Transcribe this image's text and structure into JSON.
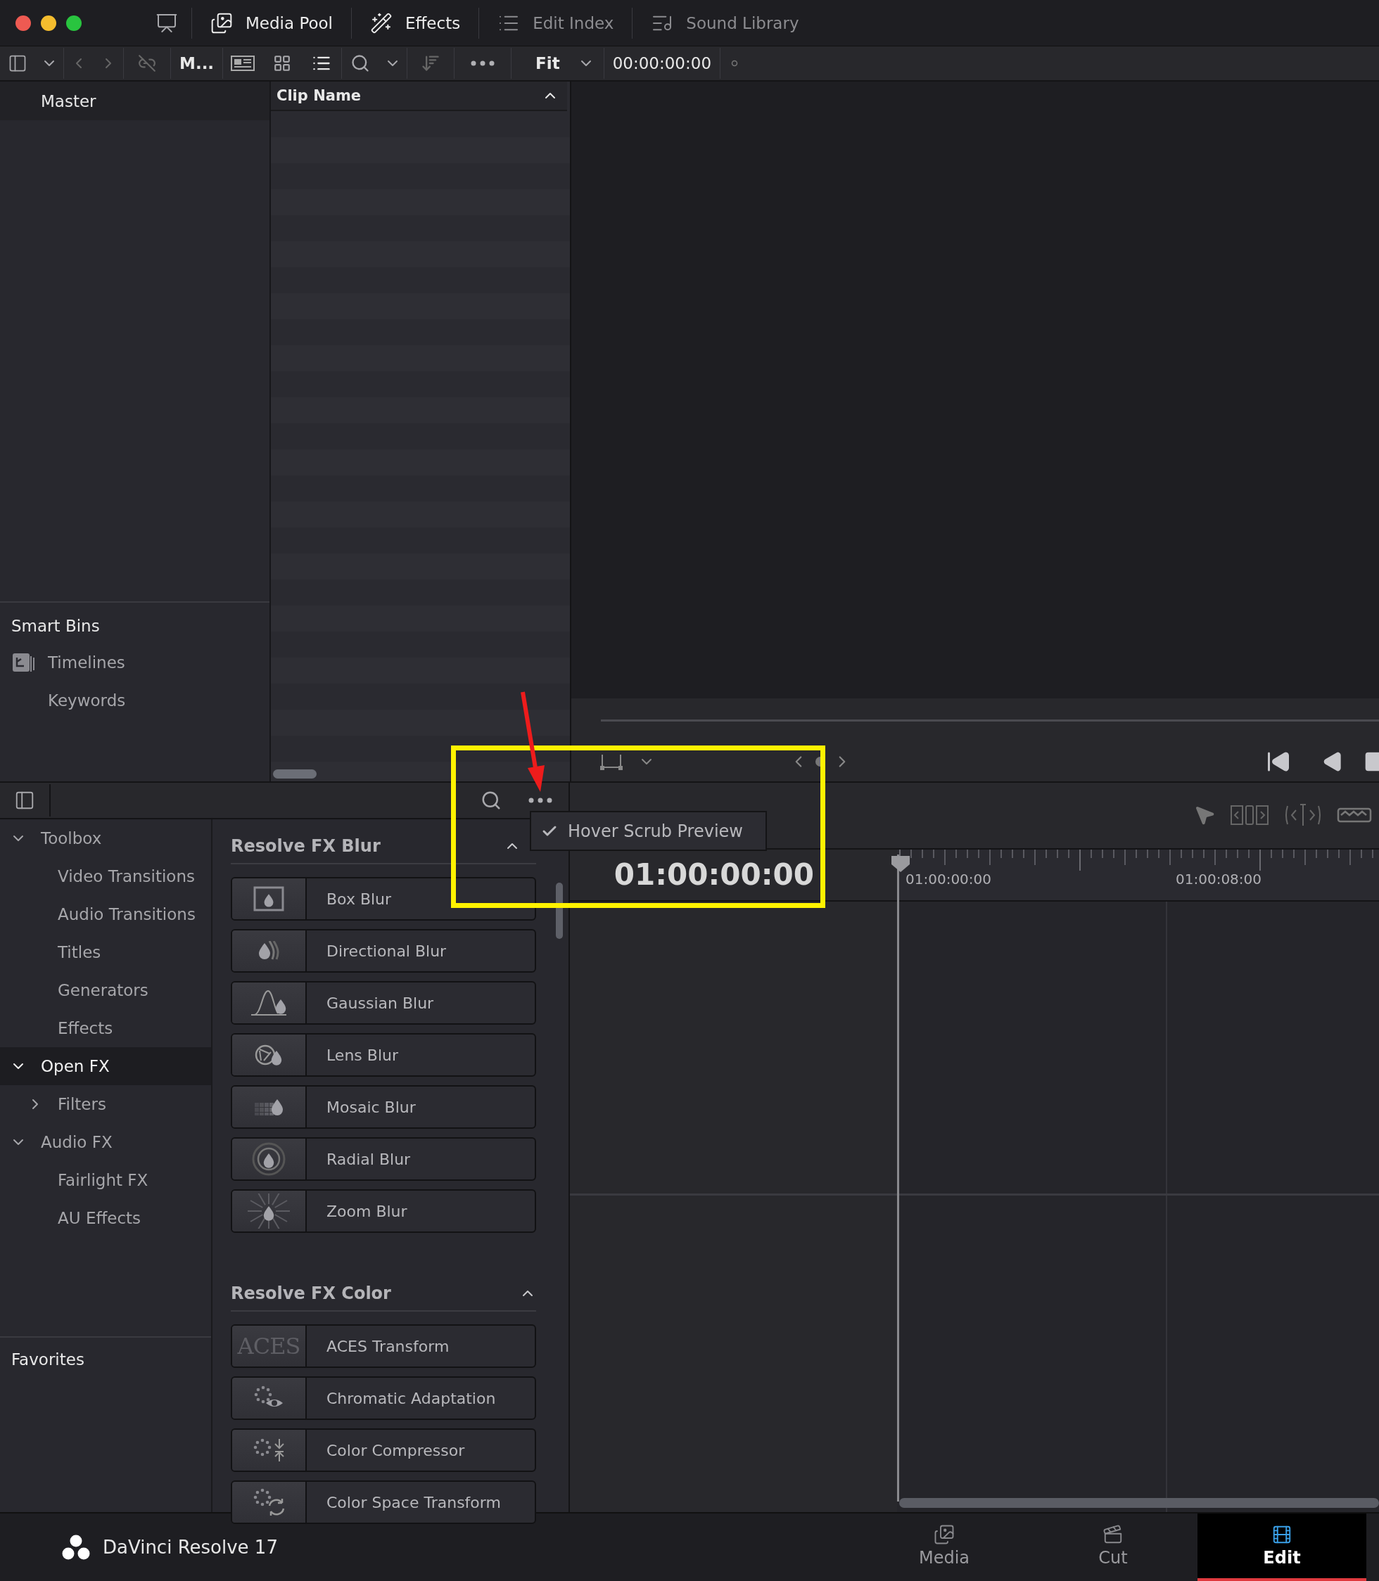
{
  "title_bar": {
    "tabs": [
      {
        "label": "Media Pool",
        "selected": true
      },
      {
        "label": "Effects",
        "selected": true
      },
      {
        "label": "Edit Index",
        "selected": false
      },
      {
        "label": "Sound Library",
        "selected": false
      }
    ]
  },
  "toolbar": {
    "bin_label": "M...",
    "zoom": "Fit",
    "timecode": "00:00:00:00"
  },
  "bins": {
    "master": "Master",
    "smart_bins_title": "Smart Bins",
    "smart_bins": [
      {
        "label": "Timelines",
        "kind": "timelines"
      },
      {
        "label": "Keywords",
        "kind": "plain"
      }
    ]
  },
  "clip_list": {
    "column": "Clip Name"
  },
  "effects": {
    "tree": [
      {
        "label": "Toolbox",
        "expanded": true,
        "selected": false,
        "children": [
          {
            "label": "Video Transitions",
            "selected": false
          },
          {
            "label": "Audio Transitions",
            "selected": false
          },
          {
            "label": "Titles",
            "selected": false
          },
          {
            "label": "Generators",
            "selected": false
          },
          {
            "label": "Effects",
            "selected": false
          }
        ]
      },
      {
        "label": "Open FX",
        "expanded": true,
        "selected": true,
        "children": [
          {
            "label": "Filters",
            "expanded": false,
            "selected": false
          }
        ]
      },
      {
        "label": "Audio FX",
        "expanded": true,
        "selected": false,
        "children": [
          {
            "label": "Fairlight FX",
            "selected": false
          },
          {
            "label": "AU Effects",
            "selected": false
          }
        ]
      }
    ],
    "favorites": "Favorites",
    "groups": [
      {
        "title": "Resolve FX Blur",
        "expanded": true,
        "items": [
          {
            "name": "Box Blur"
          },
          {
            "name": "Directional Blur"
          },
          {
            "name": "Gaussian Blur"
          },
          {
            "name": "Lens Blur"
          },
          {
            "name": "Mosaic Blur"
          },
          {
            "name": "Radial Blur"
          },
          {
            "name": "Zoom Blur"
          }
        ]
      },
      {
        "title": "Resolve FX Color",
        "expanded": true,
        "items": [
          {
            "name": "ACES Transform",
            "badge": "ACES"
          },
          {
            "name": "Chromatic Adaptation"
          },
          {
            "name": "Color Compressor"
          },
          {
            "name": "Color Space Transform"
          }
        ]
      }
    ]
  },
  "menu": {
    "items": [
      {
        "label": "Hover Scrub Preview",
        "checked": true
      }
    ]
  },
  "timeline": {
    "timecode": "01:00:00:00",
    "ruler_labels": [
      "01:00:00:00",
      "01:00:08:00"
    ]
  },
  "footer": {
    "app_name": "DaVinci Resolve 17",
    "pages": [
      {
        "label": "Media",
        "selected": false
      },
      {
        "label": "Cut",
        "selected": false
      },
      {
        "label": "Edit",
        "selected": true
      }
    ]
  }
}
